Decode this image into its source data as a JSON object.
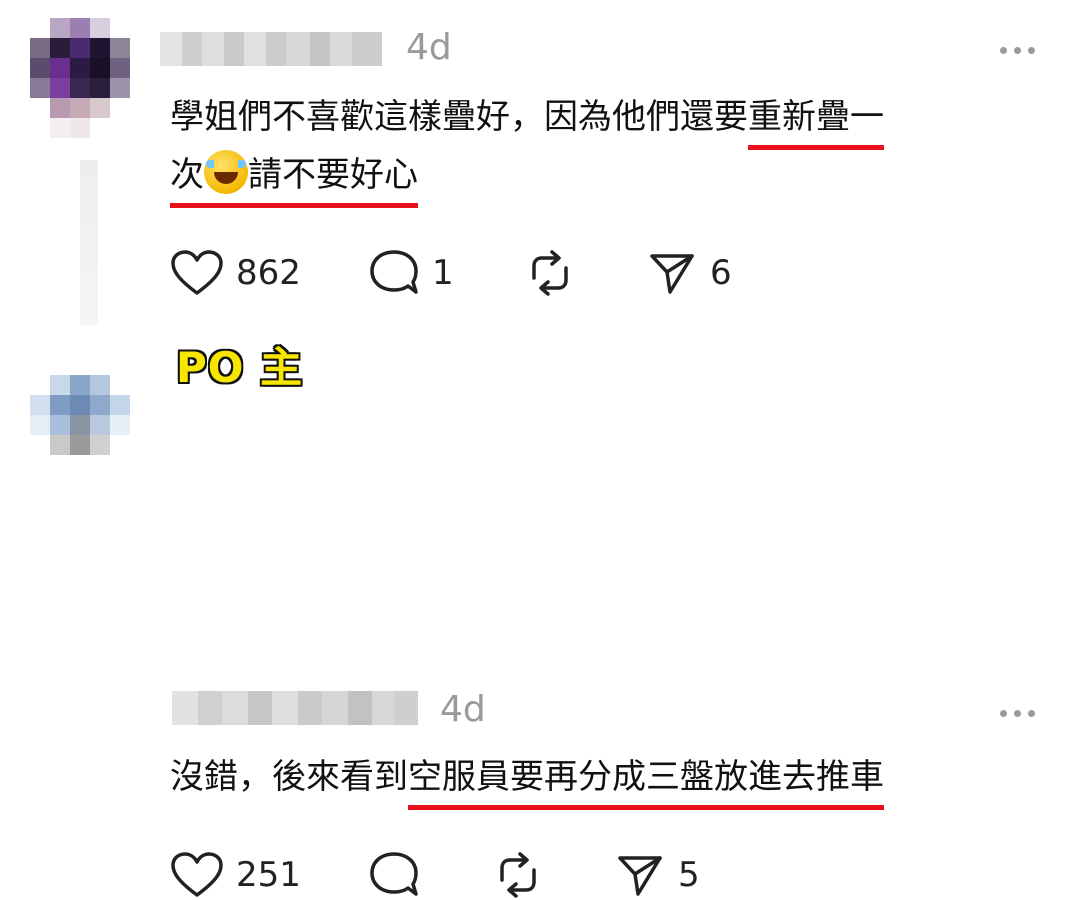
{
  "comments": [
    {
      "timestamp": "4d",
      "text_line1_plain": "學姐們不喜歡這樣疊好，因為他們還要",
      "text_line1_underlined": "重新疊一",
      "text_line2_underlined_a": "次",
      "text_line2_underlined_b": "請不要好心",
      "emoji": "face-with-tears-of-joy",
      "likes": "862",
      "replies": "1",
      "reposts": "",
      "shares": "6"
    },
    {
      "badge": "PO 主",
      "timestamp": "4d",
      "text_plain": "沒錯，後來看到",
      "text_underlined": "空服員要再分成三盤放進去推車",
      "likes": "251",
      "replies": "",
      "reposts": "",
      "shares": "5"
    }
  ],
  "colors": {
    "underline": "#e8101a",
    "badge_fill": "#f7e600",
    "muted": "#9a9a9a"
  },
  "icons": [
    "heart-icon",
    "comment-icon",
    "repost-icon",
    "share-icon",
    "more-icon"
  ]
}
